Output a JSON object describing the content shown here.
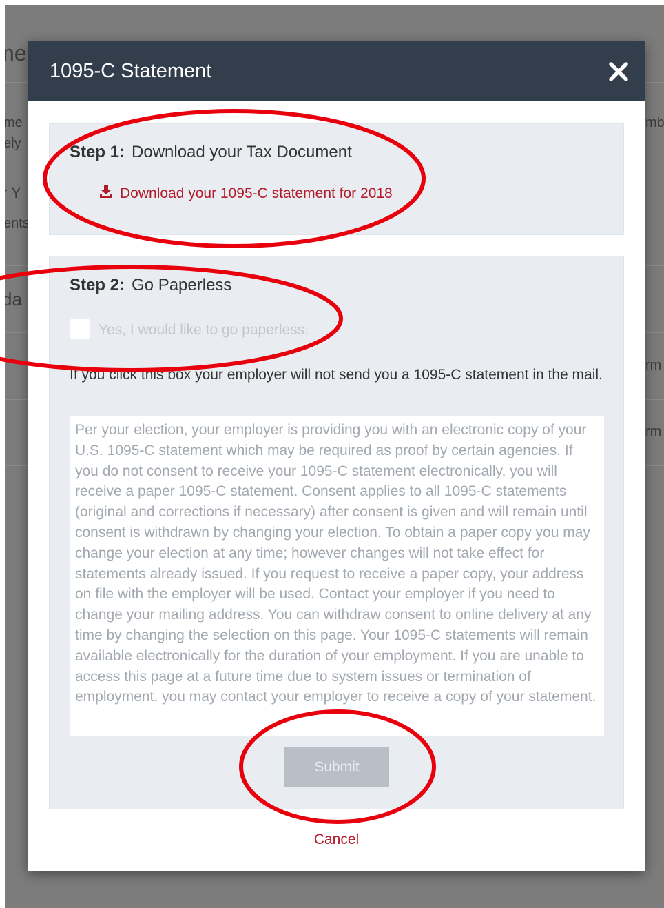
{
  "background": {
    "fragments": [
      "ne",
      "me",
      "ely",
      "r Y",
      "ents",
      "da",
      "mb",
      "rm",
      "rm"
    ]
  },
  "modal": {
    "title": "1095-C Statement",
    "close_icon": "close-icon",
    "step1": {
      "label": "Step 1:",
      "title": "Download your Tax Document",
      "link_icon": "download-icon",
      "link_text": "Download your 1095-C statement for 2018"
    },
    "step2": {
      "label": "Step 2:",
      "title": "Go Paperless",
      "checkbox_checked": false,
      "checkbox_label": "Yes, I would like to go paperless.",
      "note": "If you click this box your employer will not send you a 1095-C statement in the mail.",
      "consent_text": "Per your election, your employer is providing you with an electronic copy of your U.S. 1095-C statement which may be required as proof by certain agencies. If you do not consent to receive your 1095-C statement electronically, you will receive a paper 1095-C statement. Consent applies to all 1095-C statements (original and corrections if necessary) after consent is given and will remain until consent is withdrawn by changing your election. To obtain a paper copy you may change your election at any time; however changes will not take effect for statements already issued. If you request to receive a paper copy, your address on file with the employer will be used. Contact your employer if you need to change your mailing address. You can withdraw consent to online delivery at any time by changing the selection on this page. Your 1095-C statements will remain available electronically for the duration of your employment. If you are unable to access this page at a future time due to system issues or termination of employment, you may contact your employer to receive a copy of your statement.",
      "submit_label": "Submit"
    },
    "cancel_label": "Cancel"
  },
  "colors": {
    "header": "#333e4d",
    "link": "#b21a2b",
    "annotation": "#e8000d",
    "panel": "#e9edf1"
  }
}
